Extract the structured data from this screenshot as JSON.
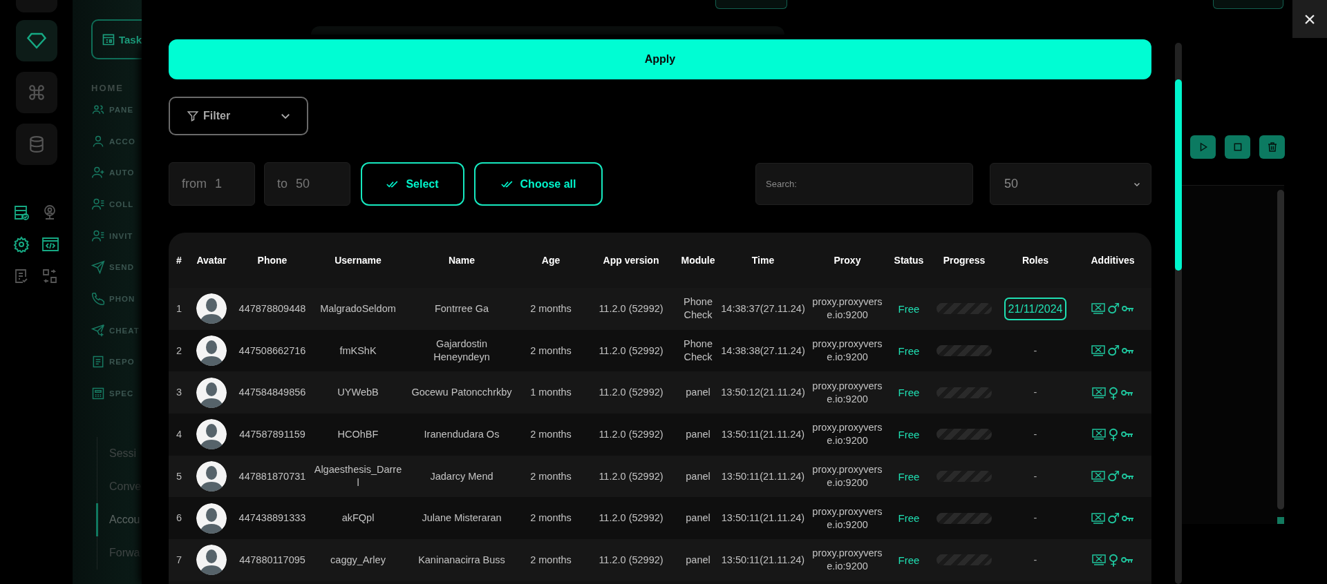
{
  "close_button": {
    "label": "×"
  },
  "sidebar": {
    "task_button": {
      "label": "Task"
    },
    "section": "HOME",
    "items": [
      {
        "label": "PANE"
      },
      {
        "label": "ACCO"
      },
      {
        "label": "AUTO"
      },
      {
        "label": "COLL"
      },
      {
        "label": "INVIT"
      },
      {
        "label": "SEND"
      },
      {
        "label": "PHON"
      },
      {
        "label": "CHEAT"
      },
      {
        "label": "REPO"
      },
      {
        "label": "SPEC"
      }
    ],
    "sub_items": [
      {
        "label": "Sessi",
        "selected": false
      },
      {
        "label": "Conve",
        "selected": false
      },
      {
        "label": "Accou",
        "selected": true
      },
      {
        "label": "Forwa",
        "selected": false
      }
    ]
  },
  "modal": {
    "apply_button": "Apply",
    "filter": {
      "label": "Filter"
    },
    "range": {
      "from_label": "from",
      "from_value": "1",
      "to_label": "to",
      "to_value": "50"
    },
    "select_button": "Select",
    "choose_all_button": "Choose all",
    "search": {
      "placeholder": "Search:"
    },
    "page_size": {
      "value": "50"
    },
    "table": {
      "columns": [
        "#",
        "Avatar",
        "Phone",
        "Username",
        "Name",
        "Age",
        "App version",
        "Module",
        "Time",
        "Proxy",
        "Status",
        "Progress",
        "Roles",
        "Additives"
      ],
      "rows": [
        {
          "index": "1",
          "phone": "447878809448",
          "username": "MalgradoSeldom",
          "name": "Fontrree Ga",
          "age": "2 months",
          "app_version": "11.2.0 (52992)",
          "module": "PhoneCheck",
          "time": "14:38:37(27.11.24)",
          "proxy": "proxy.proxyverse.io:9200",
          "status": "Free",
          "progress": {
            "level": 0
          },
          "roles": {
            "kind": "date",
            "text": "21/11/2024"
          },
          "gender": "♂"
        },
        {
          "index": "2",
          "phone": "447508662716",
          "username": "fmKShK",
          "name": "Gajardostin Heneyndeyn",
          "age": "2 months",
          "app_version": "11.2.0 (52992)",
          "module": "PhoneCheck",
          "time": "14:38:38(27.11.24)",
          "proxy": "proxy.proxyverse.io:9200",
          "status": "Free",
          "progress": {
            "level": 0
          },
          "roles": {
            "kind": "plain",
            "text": "-"
          },
          "gender": "♂"
        },
        {
          "index": "3",
          "phone": "447584849856",
          "username": "UYWebB",
          "name": "Gocewu Patoncchrkby",
          "age": "1 months",
          "app_version": "11.2.0 (52992)",
          "module": "panel",
          "time": "13:50:12(21.11.24)",
          "proxy": "proxy.proxyverse.io:9200",
          "status": "Free",
          "progress": {
            "level": 0
          },
          "roles": {
            "kind": "plain",
            "text": "-"
          },
          "gender": "♀"
        },
        {
          "index": "4",
          "phone": "447587891159",
          "username": "HCOhBF",
          "name": "Iranendudara Os",
          "age": "2 months",
          "app_version": "11.2.0 (52992)",
          "module": "panel",
          "time": "13:50:11(21.11.24)",
          "proxy": "proxy.proxyverse.io:9200",
          "status": "Free",
          "progress": {
            "level": 0
          },
          "roles": {
            "kind": "plain",
            "text": "-"
          },
          "gender": "♀"
        },
        {
          "index": "5",
          "phone": "447881870731",
          "username": "Algaesthesis_Darrel",
          "name": "Jadarcy Mend",
          "age": "2 months",
          "app_version": "11.2.0 (52992)",
          "module": "panel",
          "time": "13:50:11(21.11.24)",
          "proxy": "proxy.proxyverse.io:9200",
          "status": "Free",
          "progress": {
            "level": 0
          },
          "roles": {
            "kind": "plain",
            "text": "-"
          },
          "gender": "♂"
        },
        {
          "index": "6",
          "phone": "447438891333",
          "username": "akFQpl",
          "name": "Julane Misteraran",
          "age": "2 months",
          "app_version": "11.2.0 (52992)",
          "module": "panel",
          "time": "13:50:11(21.11.24)",
          "proxy": "proxy.proxyverse.io:9200",
          "status": "Free",
          "progress": {
            "level": 0
          },
          "roles": {
            "kind": "plain",
            "text": "-"
          },
          "gender": "♂"
        },
        {
          "index": "7",
          "phone": "447880117095",
          "username": "caggy_Arley",
          "name": "Kaninanacirra Buss",
          "age": "2 months",
          "app_version": "11.2.0 (52992)",
          "module": "panel",
          "time": "13:50:11(21.11.24)",
          "proxy": "proxy.proxyverse.io:9200",
          "status": "Free",
          "progress": {
            "level": 0
          },
          "roles": {
            "kind": "plain",
            "text": "-"
          },
          "gender": "♀"
        }
      ]
    }
  }
}
